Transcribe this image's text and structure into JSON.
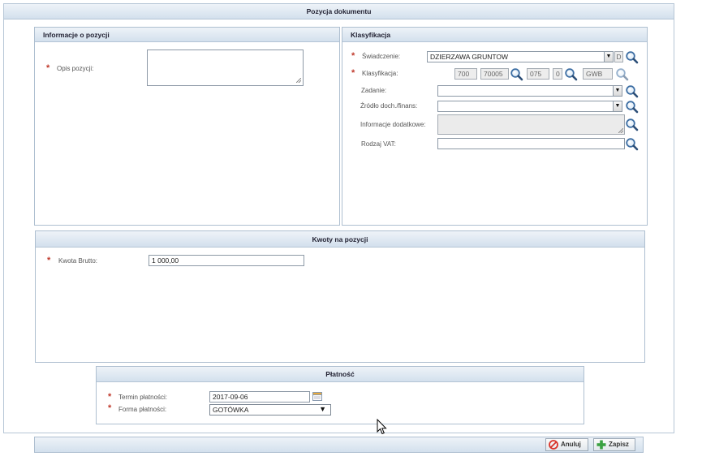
{
  "dialog": {
    "title": "Pozycja dokumentu"
  },
  "info_panel": {
    "title": "Informacje o pozycji",
    "opis_label": "Opis pozycji:",
    "opis_value": ""
  },
  "klasyfikacja_panel": {
    "title": "Klasyfikacja",
    "swiadczenie_label": "Świadczenie:",
    "swiadczenie_value": "DZIERZAWA GRUNTOW",
    "swiadczenie_code": "D",
    "klasyfikacja_label": "Klasyfikacja:",
    "klas_parts": [
      "700",
      "70005",
      "075",
      "0",
      "GWB"
    ],
    "zadanie_label": "Zadanie:",
    "zadanie_value": "",
    "zrodlo_label": "Źródło doch./finans:",
    "zrodlo_value": "",
    "info_dod_label": "Informacje dodatkowe:",
    "info_dod_value": "",
    "rodzaj_vat_label": "Rodzaj VAT:",
    "rodzaj_vat_value": ""
  },
  "kwoty_panel": {
    "title": "Kwoty na pozycji",
    "kwota_label": "Kwota Brutto:",
    "kwota_value": "1 000,00"
  },
  "platnosc_panel": {
    "title": "Płatność",
    "termin_label": "Termin płatności:",
    "termin_value": "2017-09-06",
    "forma_label": "Forma płatności:",
    "forma_value": "GOTÓWKA"
  },
  "footer": {
    "cancel_label": "Anuluj",
    "save_label": "Zapisz"
  },
  "colors": {
    "header_top": "#eef3f8",
    "header_bottom": "#d3e0ed",
    "border": "#aebfd0",
    "required": "#c0392b",
    "cancel_icon": "#d9342b",
    "save_icon": "#3aa142",
    "search_icon": "#3d6ea3"
  }
}
